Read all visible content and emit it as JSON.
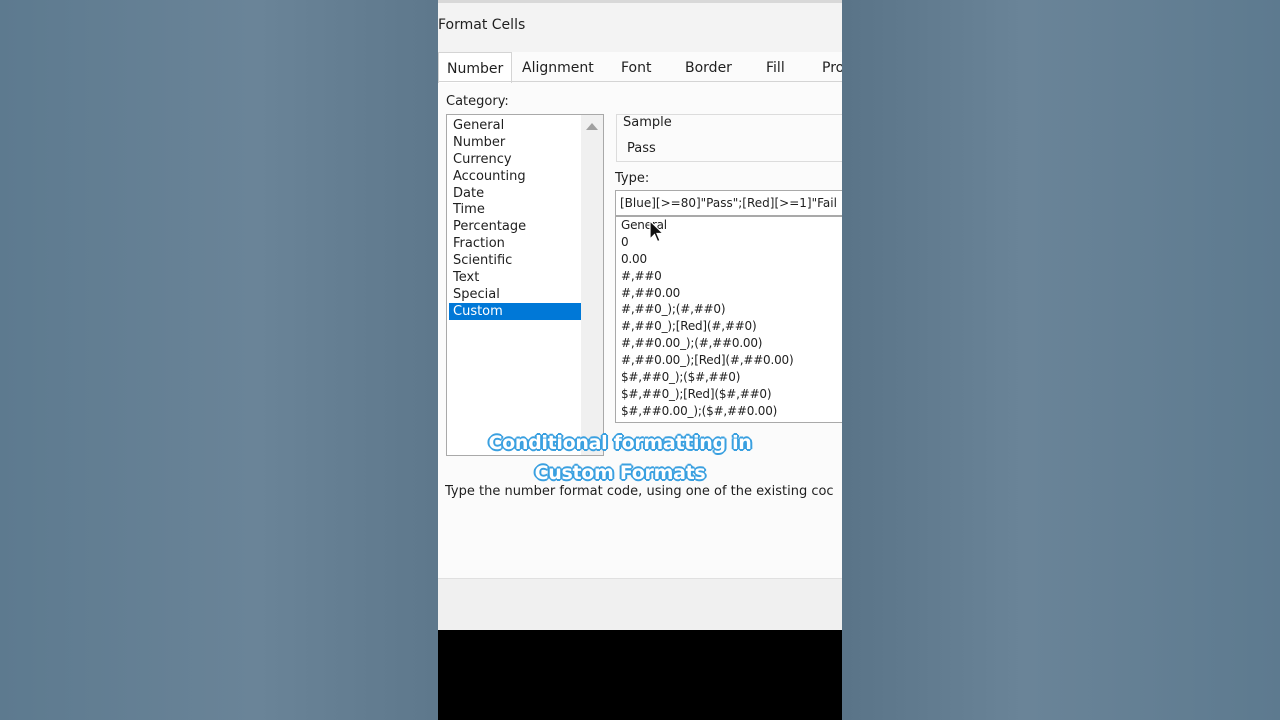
{
  "dialog": {
    "title": "Format Cells",
    "tabs": [
      "Number",
      "Alignment",
      "Font",
      "Border",
      "Fill",
      "Pro"
    ],
    "active_tab": "Number"
  },
  "category": {
    "label": "Category:",
    "items": [
      "General",
      "Number",
      "Currency",
      "Accounting",
      "Date",
      "Time",
      "Percentage",
      "Fraction",
      "Scientific",
      "Text",
      "Special",
      "Custom"
    ],
    "selected": "Custom"
  },
  "sample": {
    "legend": "Sample",
    "value": "Pass"
  },
  "type": {
    "label": "Type:",
    "value": "[Blue][>=80]\"Pass\";[Red][>=1]\"Fail",
    "items": [
      "General",
      "0",
      "0.00",
      "#,##0",
      "#,##0.00",
      "#,##0_);(#,##0)",
      "#,##0_);[Red](#,##0)",
      "#,##0.00_);(#,##0.00)",
      "#,##0.00_);[Red](#,##0.00)",
      "$#,##0_);($#,##0)",
      "$#,##0_);[Red]($#,##0)",
      "$#,##0.00_);($#,##0.00)"
    ]
  },
  "hint": "Type the number format code, using one of the existing coc",
  "overlay_caption": {
    "line1": "Conditional formatting in",
    "line2": "Custom Formats"
  },
  "colors": {
    "selection": "#0078d7",
    "caption_outline": "#3aa0e0"
  }
}
